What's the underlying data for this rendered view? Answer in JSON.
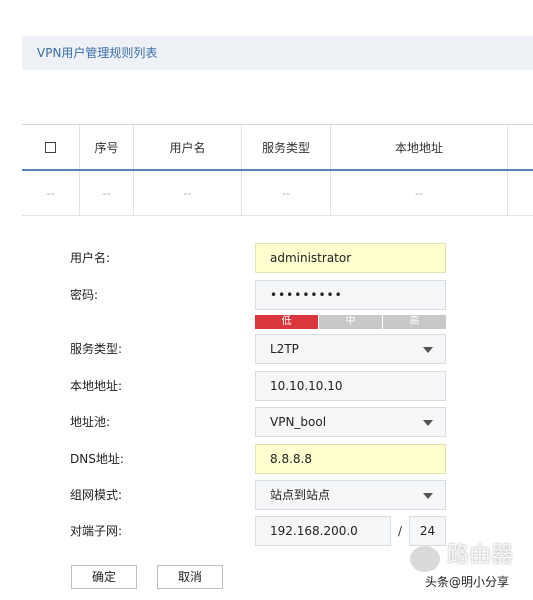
{
  "page": {
    "title": "VPN用户管理规则列表"
  },
  "table": {
    "headers": [
      "序号",
      "用户名",
      "服务类型",
      "本地地址"
    ],
    "empty_row": [
      "--",
      "--",
      "--",
      "--",
      "--"
    ]
  },
  "form": {
    "username": {
      "label": "用户名:",
      "value": "administrator"
    },
    "password": {
      "label": "密码:",
      "value": "•••••••••"
    },
    "strength": {
      "low": "低",
      "mid": "中",
      "high": "高",
      "level": "low"
    },
    "service_type": {
      "label": "服务类型:",
      "value": "L2TP"
    },
    "local_address": {
      "label": "本地地址:",
      "value": "10.10.10.10"
    },
    "address_pool": {
      "label": "地址池:",
      "value": "VPN_bool"
    },
    "dns": {
      "label": "DNS地址:",
      "value": "8.8.8.8"
    },
    "network_mode": {
      "label": "组网模式:",
      "value": "站点到站点"
    },
    "peer_subnet": {
      "label": "对端子网:",
      "ip": "192.168.200.0",
      "separator": "/",
      "mask": "24"
    }
  },
  "buttons": {
    "confirm": "确定",
    "cancel": "取消"
  },
  "watermark": {
    "site": "路由器",
    "credit": "头条@明小分享"
  },
  "colors": {
    "title_text": "#3a6ea5",
    "header_divider": "#5b85b5",
    "highlight_field": "#ffffd0",
    "strength_low": "#d9363e"
  }
}
